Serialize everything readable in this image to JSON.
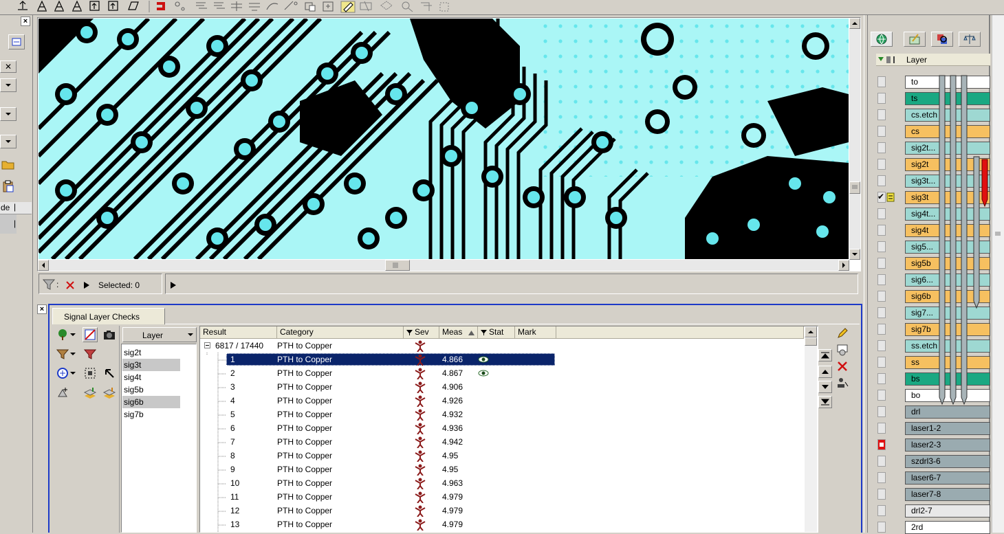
{
  "filter_bar": {
    "separator": ":",
    "selected_text": "Selected: 0"
  },
  "left_panel": {
    "fragment_label": "de"
  },
  "checks": {
    "tab_label": "Signal Layer Checks",
    "layer_dropdown_label": "Layer",
    "layers": [
      {
        "name": "sig2t",
        "highlighted": false
      },
      {
        "name": "sig3t",
        "highlighted": true
      },
      {
        "name": "sig4t",
        "highlighted": false
      },
      {
        "name": "sig5b",
        "highlighted": false
      },
      {
        "name": "sig6b",
        "highlighted": true
      },
      {
        "name": "sig7b",
        "highlighted": false
      }
    ],
    "columns": [
      "Result",
      "Category",
      "Sev",
      "Meas",
      "Stat",
      "Mark"
    ],
    "group": {
      "label": "6817 / 17440",
      "category": "PTH to Copper"
    },
    "rows": [
      {
        "result": "1",
        "category": "PTH to Copper",
        "meas": "4.866",
        "stat": "eye",
        "selected": true
      },
      {
        "result": "2",
        "category": "PTH to Copper",
        "meas": "4.867",
        "stat": "eye",
        "selected": false
      },
      {
        "result": "3",
        "category": "PTH to Copper",
        "meas": "4.906",
        "stat": "",
        "selected": false
      },
      {
        "result": "4",
        "category": "PTH to Copper",
        "meas": "4.926",
        "stat": "",
        "selected": false
      },
      {
        "result": "5",
        "category": "PTH to Copper",
        "meas": "4.932",
        "stat": "",
        "selected": false
      },
      {
        "result": "6",
        "category": "PTH to Copper",
        "meas": "4.936",
        "stat": "",
        "selected": false
      },
      {
        "result": "7",
        "category": "PTH to Copper",
        "meas": "4.942",
        "stat": "",
        "selected": false
      },
      {
        "result": "8",
        "category": "PTH to Copper",
        "meas": "4.95",
        "stat": "",
        "selected": false
      },
      {
        "result": "9",
        "category": "PTH to Copper",
        "meas": "4.95",
        "stat": "",
        "selected": false
      },
      {
        "result": "10",
        "category": "PTH to Copper",
        "meas": "4.963",
        "stat": "",
        "selected": false
      },
      {
        "result": "11",
        "category": "PTH to Copper",
        "meas": "4.979",
        "stat": "",
        "selected": false
      },
      {
        "result": "12",
        "category": "PTH to Copper",
        "meas": "4.979",
        "stat": "",
        "selected": false
      },
      {
        "result": "13",
        "category": "PTH to Copper",
        "meas": "4.979",
        "stat": "",
        "selected": false
      }
    ]
  },
  "layer_panel": {
    "header_label": "Layer",
    "layers": [
      {
        "name": "to",
        "color": "#ffffff",
        "checked": false
      },
      {
        "name": "ts",
        "color": "#1aa882",
        "checked": false
      },
      {
        "name": "cs.etch",
        "color": "#9ed8d2",
        "checked": false
      },
      {
        "name": "cs",
        "color": "#f6c060",
        "checked": false
      },
      {
        "name": "sig2t...",
        "color": "#9ed8d2",
        "checked": false
      },
      {
        "name": "sig2t",
        "color": "#f6c060",
        "checked": false
      },
      {
        "name": "sig3t...",
        "color": "#9ed8d2",
        "checked": false
      },
      {
        "name": "sig3t",
        "color": "#f6c060",
        "checked": true
      },
      {
        "name": "sig4t...",
        "color": "#9ed8d2",
        "checked": false
      },
      {
        "name": "sig4t",
        "color": "#f6c060",
        "checked": false
      },
      {
        "name": "sig5...",
        "color": "#9ed8d2",
        "checked": false
      },
      {
        "name": "sig5b",
        "color": "#f6c060",
        "checked": false
      },
      {
        "name": "sig6...",
        "color": "#9ed8d2",
        "checked": false
      },
      {
        "name": "sig6b",
        "color": "#f6c060",
        "checked": false
      },
      {
        "name": "sig7...",
        "color": "#9ed8d2",
        "checked": false
      },
      {
        "name": "sig7b",
        "color": "#f6c060",
        "checked": false
      },
      {
        "name": "ss.etch",
        "color": "#9ed8d2",
        "checked": false
      },
      {
        "name": "ss",
        "color": "#f6c060",
        "checked": false
      },
      {
        "name": "bs",
        "color": "#1aa882",
        "checked": false
      },
      {
        "name": "bo",
        "color": "#ffffff",
        "checked": false
      },
      {
        "name": "drl",
        "color": "#9aabb0",
        "checked": false
      },
      {
        "name": "laser1-2",
        "color": "#9aabb0",
        "checked": false
      },
      {
        "name": "laser2-3",
        "color": "#9aabb0",
        "checked": false
      },
      {
        "name": "szdrl3-6",
        "color": "#9aabb0",
        "checked": false
      },
      {
        "name": "laser6-7",
        "color": "#9aabb0",
        "checked": false
      },
      {
        "name": "laser7-8",
        "color": "#9aabb0",
        "checked": false
      },
      {
        "name": "drl2-7",
        "color": "#e8e8e8",
        "checked": false
      },
      {
        "name": "2rd",
        "color": "#ffffff",
        "checked": false
      }
    ]
  },
  "colors": {
    "board_copper": "#000000",
    "board_fill": "#aaf6f6",
    "board_pad": "#66e6ec",
    "selection": "#0a246a",
    "severity": "#8b1a1a",
    "accent_border": "#1c3ac8"
  },
  "icons": {
    "severity": "severity-figure-icon",
    "stat": "eye-icon",
    "filter": "funnel-icon",
    "clear": "red-x-icon",
    "play": "play-arrow-icon"
  }
}
